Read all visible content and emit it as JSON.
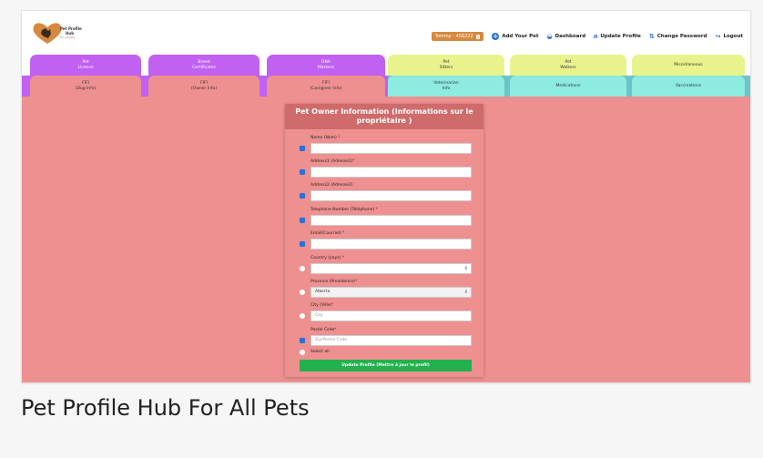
{
  "brand": {
    "logo_line1": "Pet Profile",
    "logo_line2": "Hub",
    "logo_tagline": "for all pets"
  },
  "header": {
    "user_label": "Tommy - 456222",
    "user_badge": "1",
    "nav": {
      "add_pet": "Add Your Pet",
      "dashboard": "Dashboard",
      "update_profile": "Update Profile",
      "change_password": "Change Password",
      "logout": "Logout"
    }
  },
  "tabs_row1": [
    {
      "line1": "Pet",
      "line2": "License"
    },
    {
      "line1": "Breed",
      "line2": "Certificates"
    },
    {
      "line1": "DNA",
      "line2": "Markers"
    },
    {
      "line1": "Pet",
      "line2": "Sitters"
    },
    {
      "line1": "Pet",
      "line2": "Walkers"
    },
    {
      "line1": "Miscellaneous",
      "line2": ""
    }
  ],
  "tabs_row2": [
    {
      "line1": "FIFI",
      "line2": "(Dog Info)"
    },
    {
      "line1": "FIFI",
      "line2": "(Owner Info)"
    },
    {
      "line1": "FIFI",
      "line2": "(Caregiver Info)"
    },
    {
      "line1": "Veterinarian",
      "line2": "Info"
    },
    {
      "line1": "Medications",
      "line2": ""
    },
    {
      "line1": "Vaccinations",
      "line2": ""
    }
  ],
  "form": {
    "title": "Pet Owner Information (Informations sur le propriétaire )",
    "fields": {
      "name": {
        "label": "Name (Nom)",
        "req": "*",
        "value": ""
      },
      "address1": {
        "label": "Address1 (Adresse1)",
        "req": "*",
        "value": ""
      },
      "address2": {
        "label": "Address2 (Adresse2)",
        "req": "",
        "value": ""
      },
      "telephone": {
        "label": "Telephone Number (Téléphone)",
        "req": "*",
        "value": ""
      },
      "email": {
        "label": "Email(Courriel)",
        "req": "*",
        "value": ""
      },
      "country": {
        "label": "Country (pays)",
        "req": "*",
        "value": ""
      },
      "province": {
        "label": "Province (Providence)",
        "req": "*",
        "value": "Alberta"
      },
      "city": {
        "label": "City (Ville)",
        "req": "*",
        "placeholder": "City"
      },
      "postal": {
        "label": "Postal Code",
        "req": "*",
        "placeholder": "Zip/Postal Code"
      }
    },
    "select_all": "Select all",
    "submit": "Update Profile (Mettre à jour le profil)"
  },
  "caption": "Pet Profile Hub For All Pets",
  "colors": {
    "purple": "#c061f1",
    "yellow": "#e8f48b",
    "cyan": "#8debe0",
    "salmon": "#ef9090",
    "green": "#22b14c",
    "orange": "#d6893e"
  }
}
